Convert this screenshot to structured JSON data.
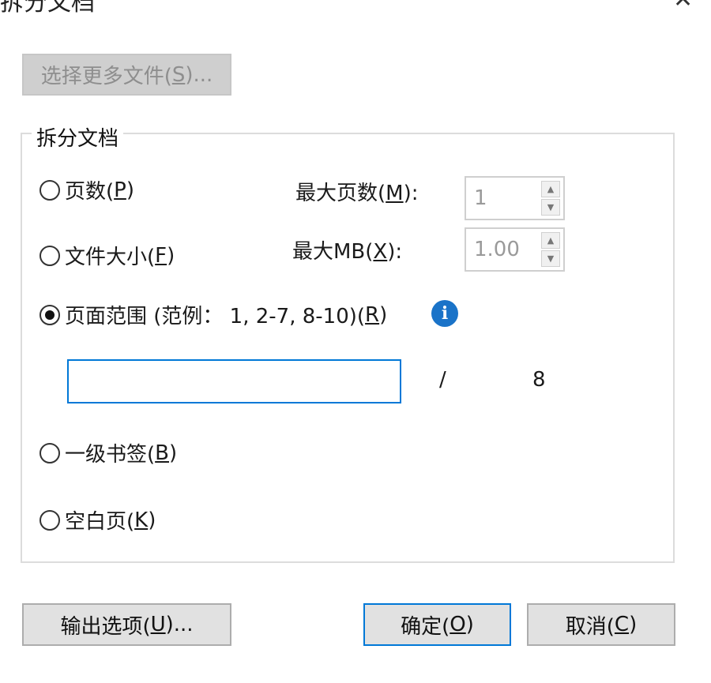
{
  "window": {
    "title": "拆分文档",
    "close_glyph": "✕"
  },
  "select_more": {
    "prefix": "选择更多文件(",
    "key": "S",
    "suffix": ")..."
  },
  "group": {
    "legend": "拆分文档"
  },
  "options": {
    "pages": {
      "prefix": "页数(",
      "key": "P",
      "suffix": ")"
    },
    "file_size": {
      "prefix": "文件大小(",
      "key": "F",
      "suffix": ")"
    },
    "page_range": {
      "prefix": "页面范围 (范例： 1, 2-7, 8-10)(",
      "key": "R",
      "suffix": ")"
    },
    "bookmarks": {
      "prefix": "一级书签(",
      "key": "B",
      "suffix": ")"
    },
    "blank_page": {
      "prefix": "空白页(",
      "key": "K",
      "suffix": ")"
    }
  },
  "max_pages": {
    "prefix": "最大页数(",
    "key": "M",
    "suffix": "):",
    "value": "1"
  },
  "max_mb": {
    "prefix": "最大MB(",
    "key": "X",
    "suffix": "):",
    "value": "1.00"
  },
  "range": {
    "value": "",
    "separator": "/",
    "total": "8"
  },
  "buttons": {
    "output": {
      "prefix": "输出选项(",
      "key": "U",
      "suffix": ")..."
    },
    "ok": {
      "prefix": "确定(",
      "key": "O",
      "suffix": ")"
    },
    "cancel": {
      "prefix": "取消(",
      "key": "C",
      "suffix": ")"
    }
  },
  "icons": {
    "info": "info-icon",
    "radio": "radio-icon"
  },
  "colors": {
    "accent": "#0078d7",
    "info": "#1a73c8"
  }
}
